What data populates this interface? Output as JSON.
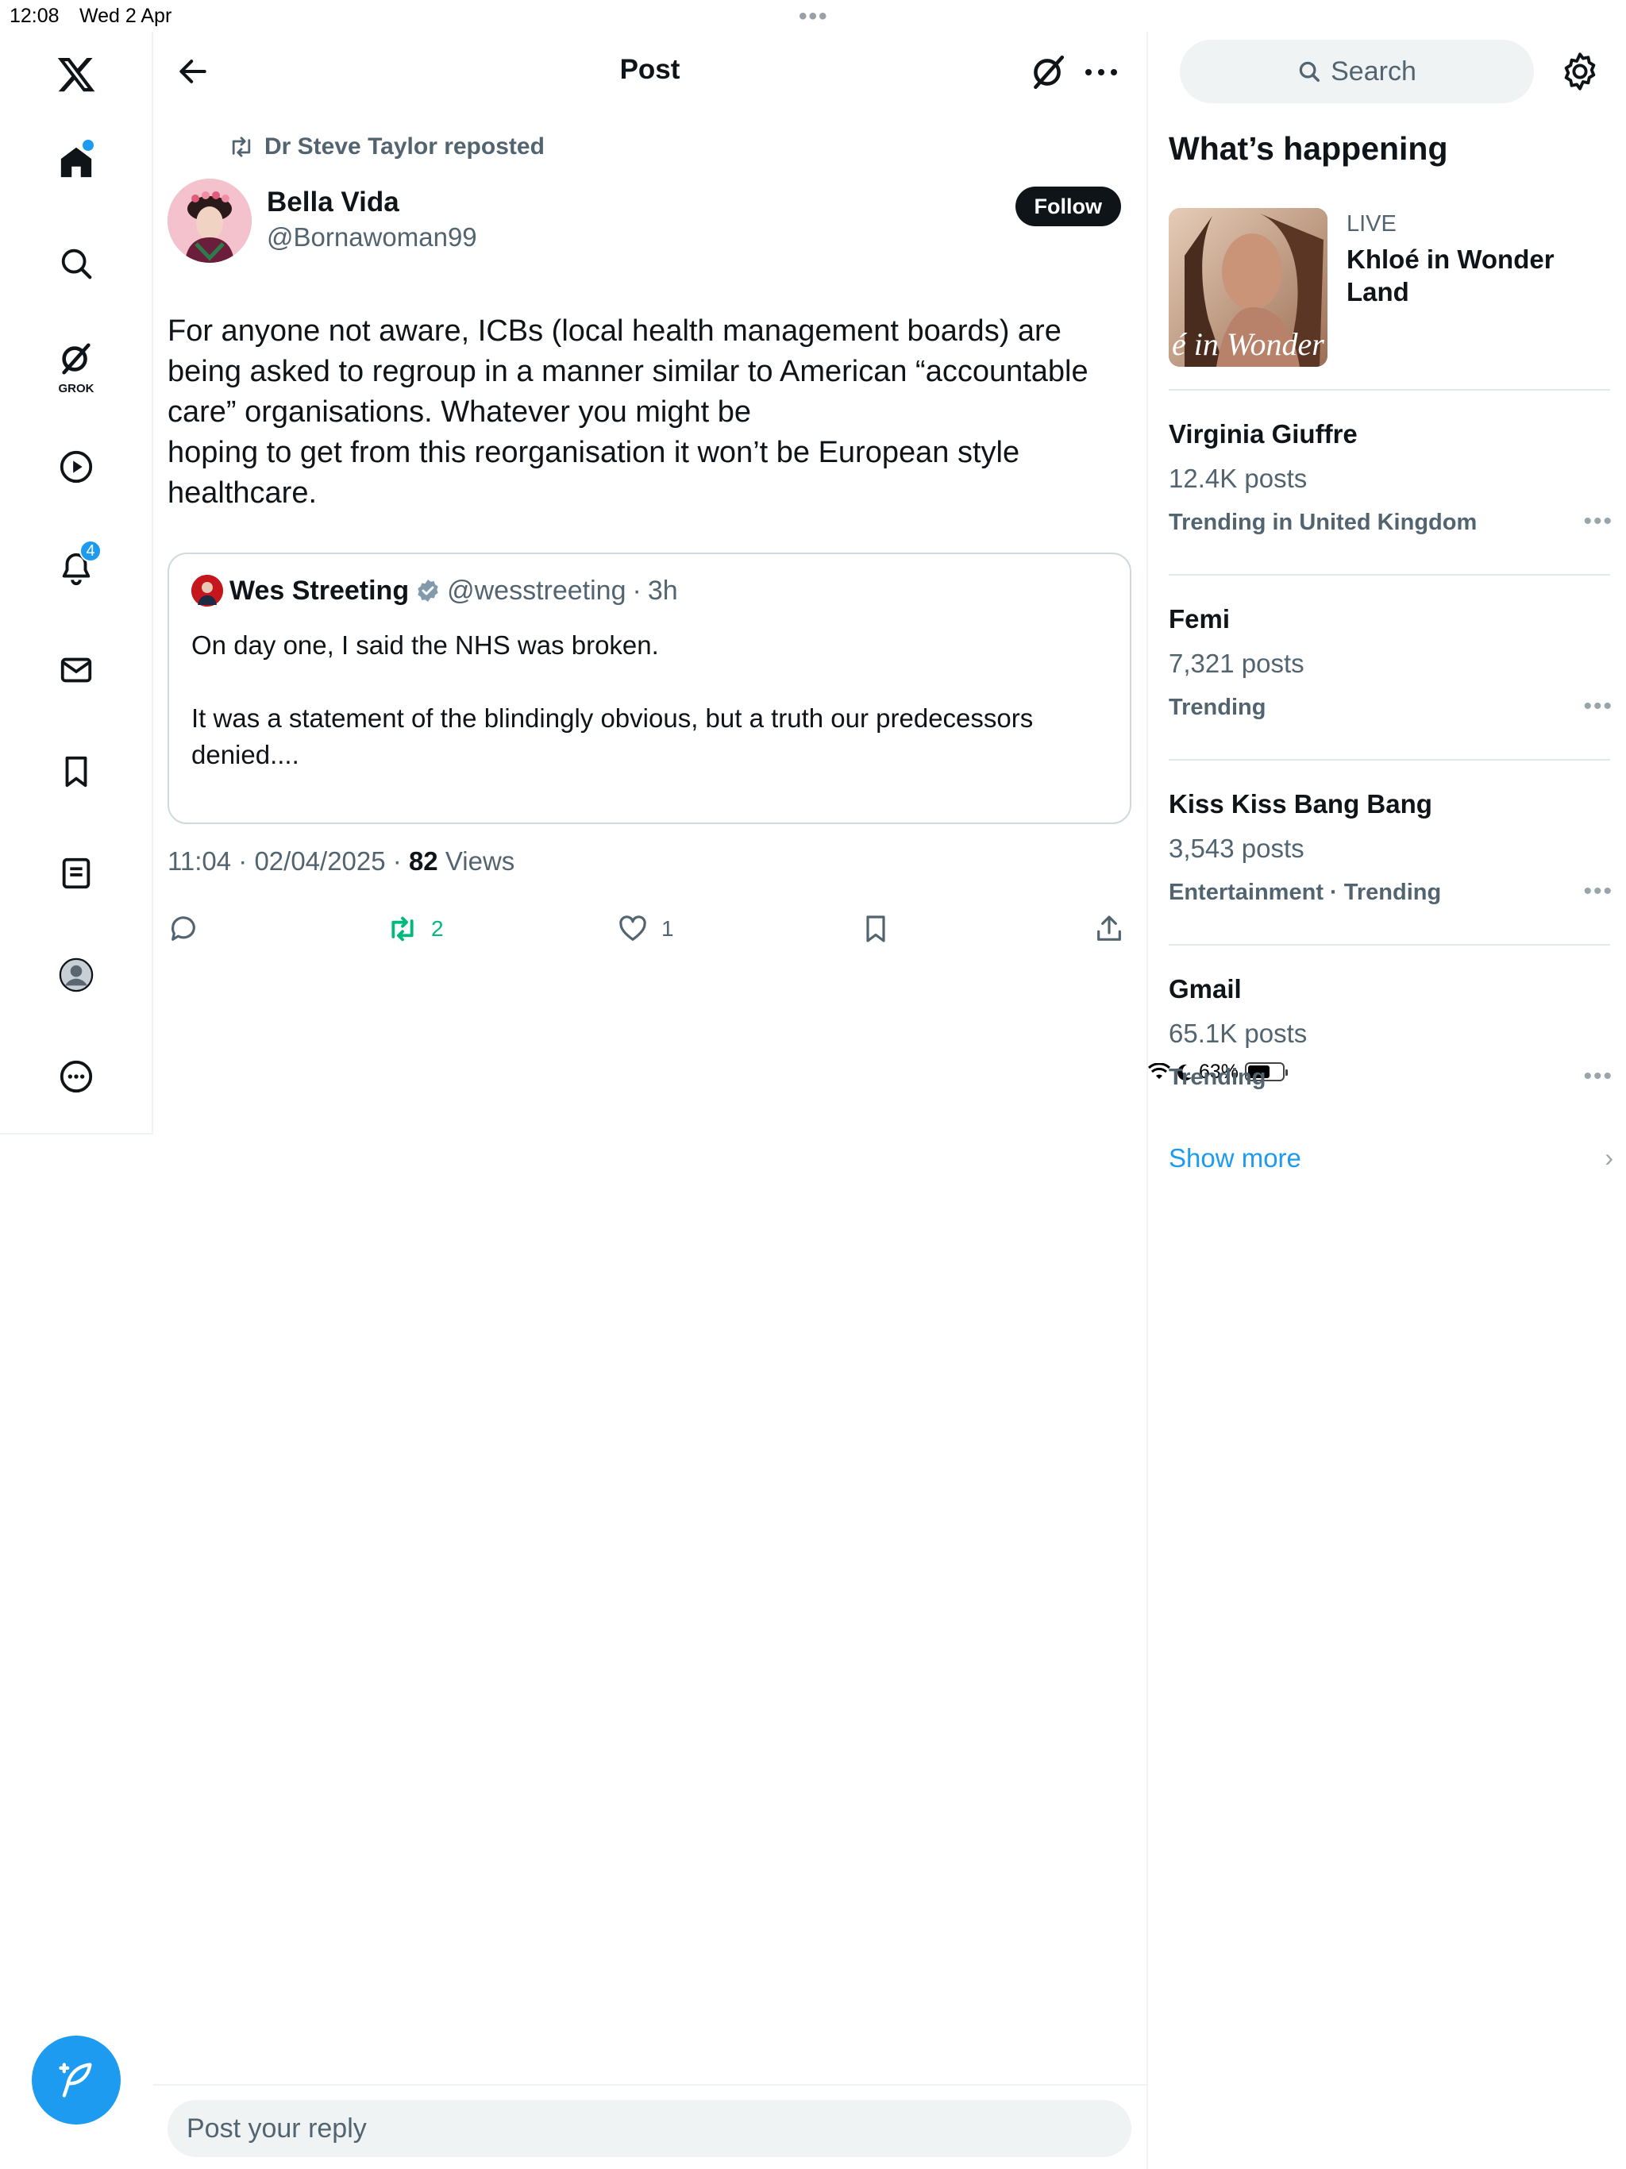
{
  "status_bar": {
    "time": "12:08",
    "date": "Wed 2 Apr",
    "battery": "63%",
    "battery_level_percent": 63
  },
  "nav": {
    "notifications_badge": "4",
    "grok_label": "GROK"
  },
  "header": {
    "title": "Post"
  },
  "post": {
    "repost_text": "Dr Steve Taylor reposted",
    "author_name": "Bella Vida",
    "author_handle": "@Bornawoman99",
    "follow_label": "Follow",
    "text_lines": [
      "For anyone not aware, ICBs (local health management boards) are",
      "being asked to regroup in a manner similar to American “accountable",
      "care” organisations. Whatever you might be",
      "hoping to get from this reorganisation it won’t be European style",
      "healthcare."
    ],
    "quote": {
      "name": "Wes Streeting",
      "handle": "@wesstreeting",
      "time": "3h",
      "line1": "On day one, I said the NHS was broken.",
      "line2": "It was a statement of the blindingly obvious, but a truth our predecessors",
      "line3": "denied...."
    },
    "timestamp": "11:04 · 02/04/2025 · ",
    "views_count": "82",
    "views_label": " Views",
    "repost_count": "2",
    "like_count": "1"
  },
  "reply": {
    "placeholder": "Post your reply"
  },
  "sidebar": {
    "search_placeholder": "Search",
    "whats_happening": "What’s happening",
    "live": {
      "label": "LIVE",
      "title": "Khloé in Wonder Land",
      "image_text": "é in Wonder l"
    },
    "trends": [
      {
        "name": "Virginia Giuffre",
        "count": "12.4K posts",
        "context": "Trending in United Kingdom"
      },
      {
        "name": "Femi",
        "count": "7,321 posts",
        "context": "Trending"
      },
      {
        "name": "Kiss Kiss Bang Bang",
        "count": "3,543 posts",
        "context": "Entertainment · Trending"
      },
      {
        "name": "Gmail",
        "count": "65.1K posts",
        "context": "Trending"
      }
    ],
    "show_more": "Show more"
  },
  "colors": {
    "accent": "#1d9bf0",
    "repost_active": "#00ba7c",
    "text_primary": "#0f1419",
    "text_secondary": "#536471"
  }
}
